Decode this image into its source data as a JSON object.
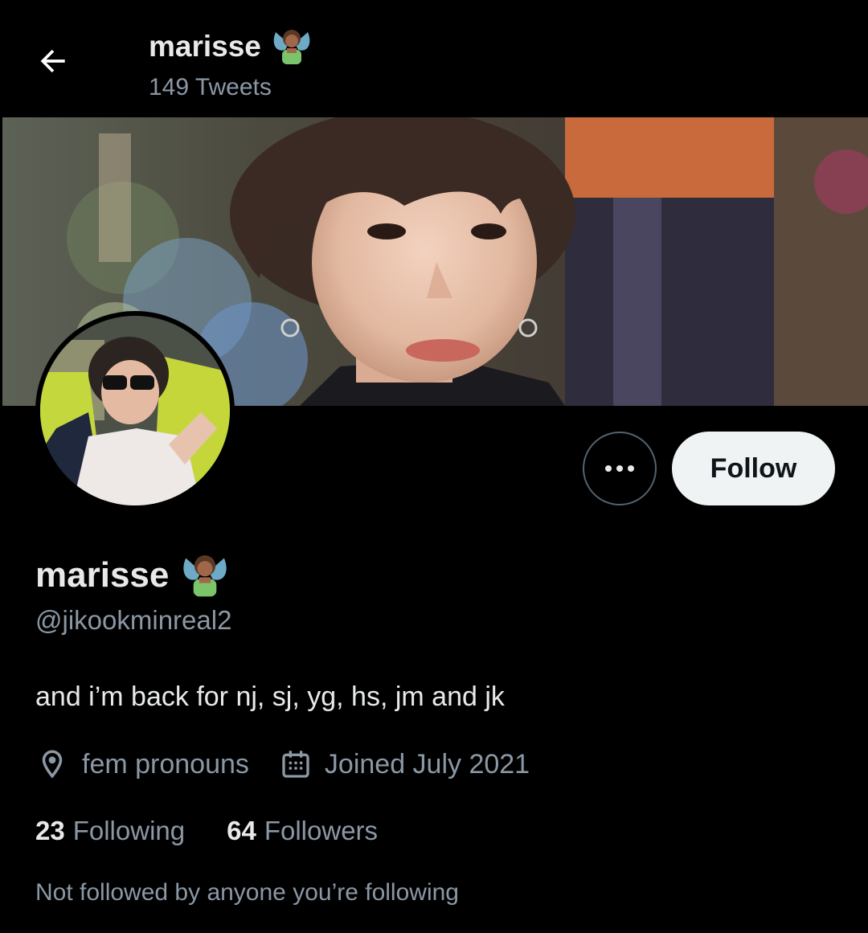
{
  "header": {
    "name": "marisse",
    "tweet_count": "149 Tweets"
  },
  "profile": {
    "name": "marisse",
    "handle": "@jikookminreal2",
    "bio": "and i’m back for nj, sj, yg, hs, jm and jk",
    "location": "fem pronouns",
    "joined": "Joined July 2021",
    "following_count": "23",
    "following_label": "Following",
    "followers_count": "64",
    "followers_label": "Followers",
    "social_context": "Not followed by anyone you’re following"
  },
  "actions": {
    "follow_label": "Follow"
  },
  "icons": {
    "back": "arrow-left-icon",
    "more": "more-dots-icon",
    "location": "location-pin-icon",
    "calendar": "calendar-icon",
    "badge": "fairy-emoji-icon"
  },
  "colors": {
    "background": "#000000",
    "text_primary": "#e7e9ea",
    "text_secondary": "#8b98a5",
    "follow_button_bg": "#eff3f4"
  }
}
